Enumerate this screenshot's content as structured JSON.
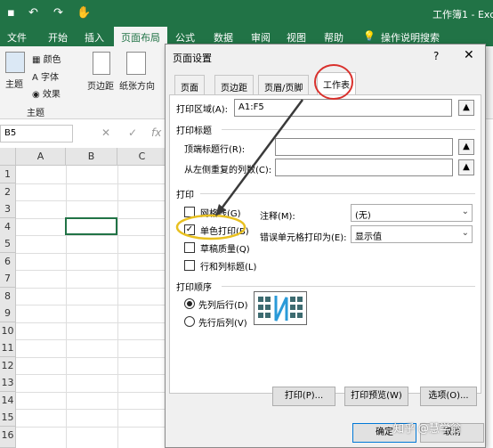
{
  "app": {
    "window_title": "工作簿1 - Exc"
  },
  "ribbon": {
    "tabs": [
      "文件",
      "开始",
      "插入",
      "页面布局",
      "公式",
      "数据",
      "审阅",
      "视图",
      "帮助",
      "操作说明搜索"
    ],
    "theme_group": {
      "label": "主题",
      "theme_button": "主题",
      "colors": "颜色",
      "fonts": "字体",
      "effects": "效果"
    },
    "page_setup": {
      "margins": "页边距",
      "orientation": "纸张方向"
    }
  },
  "formula_bar": {
    "name_box": "B5",
    "cancel": "✕",
    "enter": "✓",
    "fx": "fx"
  },
  "grid": {
    "columns": [
      "A",
      "B",
      "C"
    ],
    "rows": [
      "1",
      "2",
      "3",
      "4",
      "5",
      "6",
      "7",
      "8",
      "9",
      "10",
      "11",
      "12",
      "13",
      "14",
      "15",
      "16"
    ],
    "selected": "B5"
  },
  "dialog": {
    "title": "页面设置",
    "help": "?",
    "close": "✕",
    "tabs": [
      "页面",
      "页边距",
      "页眉/页脚",
      "工作表"
    ],
    "active_tab": "工作表",
    "print_area": {
      "label": "打印区域(A):",
      "value": "A1:F5"
    },
    "print_titles": {
      "heading": "打印标题",
      "rows_label": "顶端标题行(R):",
      "cols_label": "从左侧重复的列数(C):",
      "rows_value": "",
      "cols_value": ""
    },
    "print": {
      "heading": "打印",
      "gridlines": {
        "label": "网格线(G)",
        "checked": false
      },
      "black_white": {
        "label": "单色打印(B)",
        "checked": true
      },
      "draft": {
        "label": "草稿质量(Q)",
        "checked": false
      },
      "headings": {
        "label": "行和列标题(L)",
        "checked": false
      },
      "comments": {
        "label": "注释(M):",
        "value": "(无)"
      },
      "errors": {
        "label": "错误单元格打印为(E):",
        "value": "显示值"
      }
    },
    "page_order": {
      "heading": "打印顺序",
      "down_then_over": {
        "label": "先列后行(D)",
        "selected": true
      },
      "over_then_down": {
        "label": "先行后列(V)",
        "selected": false
      }
    },
    "buttons": {
      "print": "打印(P)...",
      "preview": "打印预览(W)",
      "options": "选项(O)...",
      "ok": "确定",
      "cancel": "取消"
    }
  },
  "watermark": "知乎 @慧学翁",
  "colors": {
    "excel_green": "#217346",
    "annotation_red": "#d9302c",
    "annotation_yellow": "#e8c020",
    "arrow": "#3a3a3a"
  }
}
